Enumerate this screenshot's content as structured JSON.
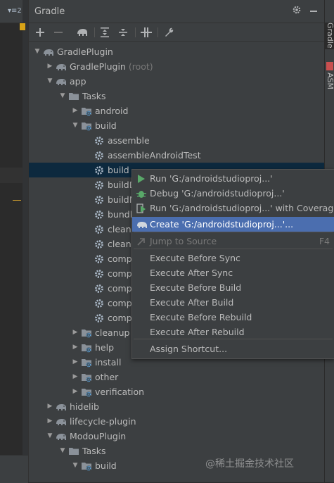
{
  "editor": {
    "tab_menu": "▾≡2"
  },
  "panel": {
    "title": "Gradle"
  },
  "right_tabs": [
    {
      "label": "Gradle"
    },
    {
      "label": "ASM"
    }
  ],
  "tree": {
    "rows": [
      {
        "label": "GradlePlugin",
        "suffix": ""
      },
      {
        "label": "GradlePlugin",
        "suffix": "(root)"
      },
      {
        "label": "app",
        "suffix": ""
      },
      {
        "label": "Tasks",
        "suffix": ""
      },
      {
        "label": "android",
        "suffix": ""
      },
      {
        "label": "build",
        "suffix": ""
      },
      {
        "label": "assemble",
        "suffix": ""
      },
      {
        "label": "assembleAndroidTest",
        "suffix": ""
      },
      {
        "label": "build",
        "suffix": ""
      },
      {
        "label": "buildD",
        "suffix": ""
      },
      {
        "label": "buildN",
        "suffix": ""
      },
      {
        "label": "bundle",
        "suffix": ""
      },
      {
        "label": "clean",
        "suffix": ""
      },
      {
        "label": "cleanB",
        "suffix": ""
      },
      {
        "label": "compi",
        "suffix": ""
      },
      {
        "label": "compi",
        "suffix": ""
      },
      {
        "label": "compi",
        "suffix": ""
      },
      {
        "label": "compi",
        "suffix": ""
      },
      {
        "label": "compi",
        "suffix": ""
      },
      {
        "label": "cleanup",
        "suffix": ""
      },
      {
        "label": "help",
        "suffix": ""
      },
      {
        "label": "install",
        "suffix": ""
      },
      {
        "label": "other",
        "suffix": ""
      },
      {
        "label": "verification",
        "suffix": ""
      },
      {
        "label": "hidelib",
        "suffix": ""
      },
      {
        "label": "lifecycle-plugin",
        "suffix": ""
      },
      {
        "label": "ModouPlugin",
        "suffix": ""
      },
      {
        "label": "Tasks",
        "suffix": ""
      },
      {
        "label": "build",
        "suffix": ""
      }
    ]
  },
  "context_menu": {
    "items": [
      {
        "label": "Run 'G:/androidstudioproj...'",
        "shortcut": ""
      },
      {
        "label": "Debug 'G:/androidstudioproj...'",
        "shortcut": ""
      },
      {
        "label": "Run 'G:/androidstudioproj...' with Coverage",
        "shortcut": ""
      },
      {
        "label": "Create 'G:/androidstudioproj...'...",
        "shortcut": ""
      },
      {
        "label": "Jump to Source",
        "shortcut": "F4"
      },
      {
        "label": "Execute Before Sync",
        "shortcut": ""
      },
      {
        "label": "Execute After Sync",
        "shortcut": ""
      },
      {
        "label": "Execute Before Build",
        "shortcut": ""
      },
      {
        "label": "Execute After Build",
        "shortcut": ""
      },
      {
        "label": "Execute Before Rebuild",
        "shortcut": ""
      },
      {
        "label": "Execute After Rebuild",
        "shortcut": ""
      },
      {
        "label": "Assign Shortcut...",
        "shortcut": ""
      }
    ]
  },
  "watermark": "@稀土掘金技术社区",
  "colors": {
    "accent": "#4b6eaf",
    "selection": "#0d293e",
    "background": "#3c3f41"
  }
}
